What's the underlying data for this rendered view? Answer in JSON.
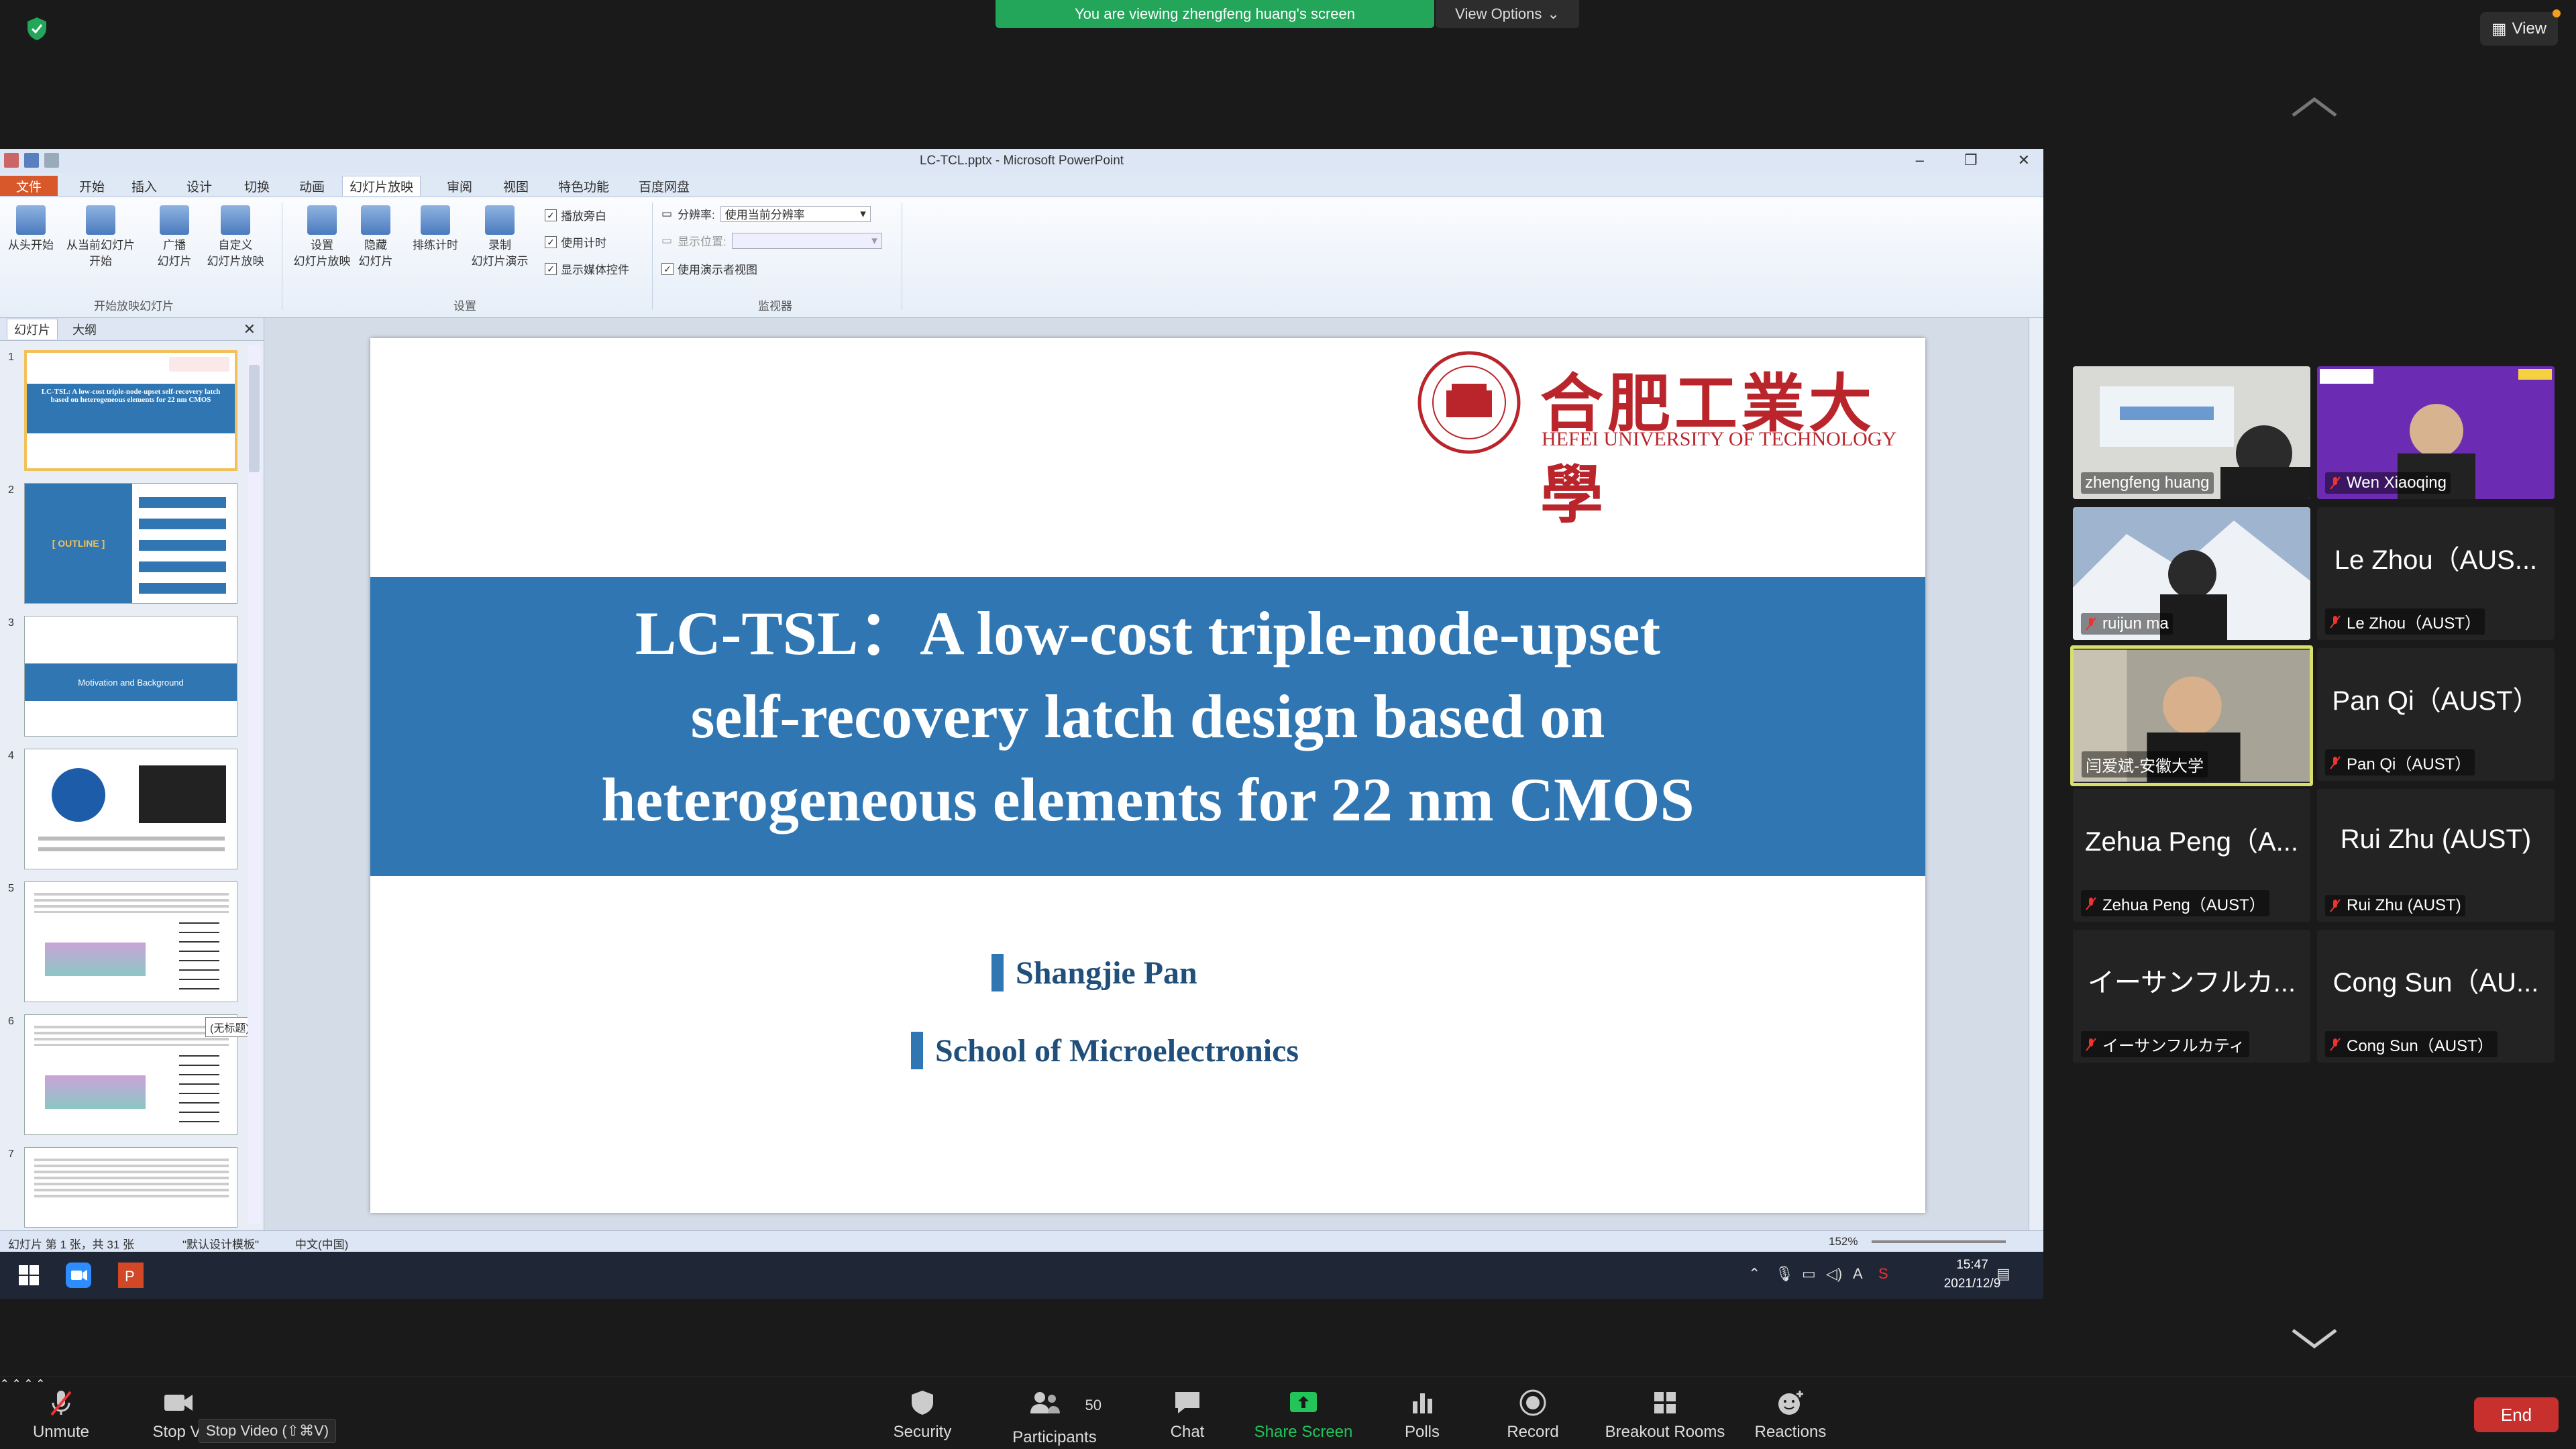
{
  "zoom": {
    "banner": "You are viewing zhengfeng huang's screen",
    "view_options": "View Options",
    "view_button": "View"
  },
  "ppt": {
    "window_title": "LC-TCL.pptx - Microsoft PowerPoint",
    "tabs": [
      "文件",
      "开始",
      "插入",
      "设计",
      "切换",
      "动画",
      "幻灯片放映",
      "审阅",
      "视图",
      "特色功能",
      "百度网盘"
    ],
    "ribbon": {
      "from_start": "从头开始",
      "from_current": "从当前幻灯片",
      "from_current2": "开始",
      "broadcast": "广播",
      "broadcast2": "幻灯片",
      "custom": "自定义",
      "custom2": "幻灯片放映",
      "group_start": "开始放映幻灯片",
      "setup": "设置",
      "setup2": "幻灯片放映",
      "hide": "隐藏",
      "hide2": "幻灯片",
      "rehearse": "排练计时",
      "record": "录制",
      "record2": "幻灯片演示",
      "chk_narration": "播放旁白",
      "chk_timing": "使用计时",
      "chk_media": "显示媒体控件",
      "group_setup": "设置",
      "resolution_label": "分辨率:",
      "resolution_value": "使用当前分辨率",
      "display_label": "显示位置:",
      "display_value": "",
      "presenter_view": "使用演示者视图",
      "group_monitor": "监视器"
    },
    "pane_tabs": [
      "幻灯片",
      "大纲"
    ],
    "thumb_numbers": [
      "1",
      "2",
      "3",
      "4",
      "5",
      "6",
      "7"
    ],
    "thumb_texts": {
      "t1": "LC-TSL: A low-cost triple-node-upset self-recovery latch based on heterogeneous elements for 22 nm CMOS",
      "t2": "[ OUTLINE ]",
      "t3": "Motivation and Background"
    },
    "tooltip": "(无标题)",
    "slide": {
      "univ_cn": "合肥工業大學",
      "univ_en": "HEFEI UNIVERSITY OF TECHNOLOGY",
      "title_line1": "LC-TSL：A low-cost triple-node-upset",
      "title_line2": "self-recovery latch design based on",
      "title_line3": "heterogeneous elements for 22 nm CMOS",
      "author": "Shangjie Pan",
      "school": "School of Microelectronics"
    },
    "status": {
      "slide_pos": "幻灯片 第 1 张，共 31 张",
      "theme": "\"默认设计模板\"",
      "lang": "中文(中国)",
      "zoom": "152%"
    },
    "taskbar": {
      "time": "15:47",
      "date": "2021/12/9"
    }
  },
  "participants": [
    {
      "name": "zhengfeng huang",
      "big": "",
      "muted": false
    },
    {
      "name": "Wen Xiaoqing",
      "big": "",
      "muted": true
    },
    {
      "name": "ruijun ma",
      "big": "",
      "muted": true
    },
    {
      "name": "Le Zhou（AUST）",
      "big": "Le Zhou（AUS...",
      "muted": true
    },
    {
      "name": "闫爱斌-安徽大学",
      "big": "",
      "muted": false
    },
    {
      "name": "Pan Qi（AUST）",
      "big": "Pan Qi（AUST）",
      "muted": true
    },
    {
      "name": "Zehua Peng（AUST）",
      "big": "Zehua Peng（A...",
      "muted": true
    },
    {
      "name": "Rui Zhu (AUST)",
      "big": "Rui Zhu (AUST)",
      "muted": true
    },
    {
      "name": "イーサンフルカティ",
      "big": "イーサンフルカ...",
      "muted": true
    },
    {
      "name": "Cong Sun（AUST）",
      "big": "Cong Sun（AU...",
      "muted": true
    }
  ],
  "toolbar": {
    "unmute": "Unmute",
    "stop_video": "Stop Vi",
    "stop_video_tip": "Stop Video (⇧⌘V)",
    "security": "Security",
    "participants": "Participants",
    "participants_count": "50",
    "chat": "Chat",
    "share_screen": "Share Screen",
    "polls": "Polls",
    "record": "Record",
    "breakout": "Breakout Rooms",
    "reactions": "Reactions",
    "end": "End"
  },
  "colors": {
    "banner_green": "#23a55a",
    "slide_blue": "#2f76b2",
    "univ_red": "#b9252b",
    "end_red": "#c8302e",
    "speaker_highlight": "#d6e06a"
  }
}
